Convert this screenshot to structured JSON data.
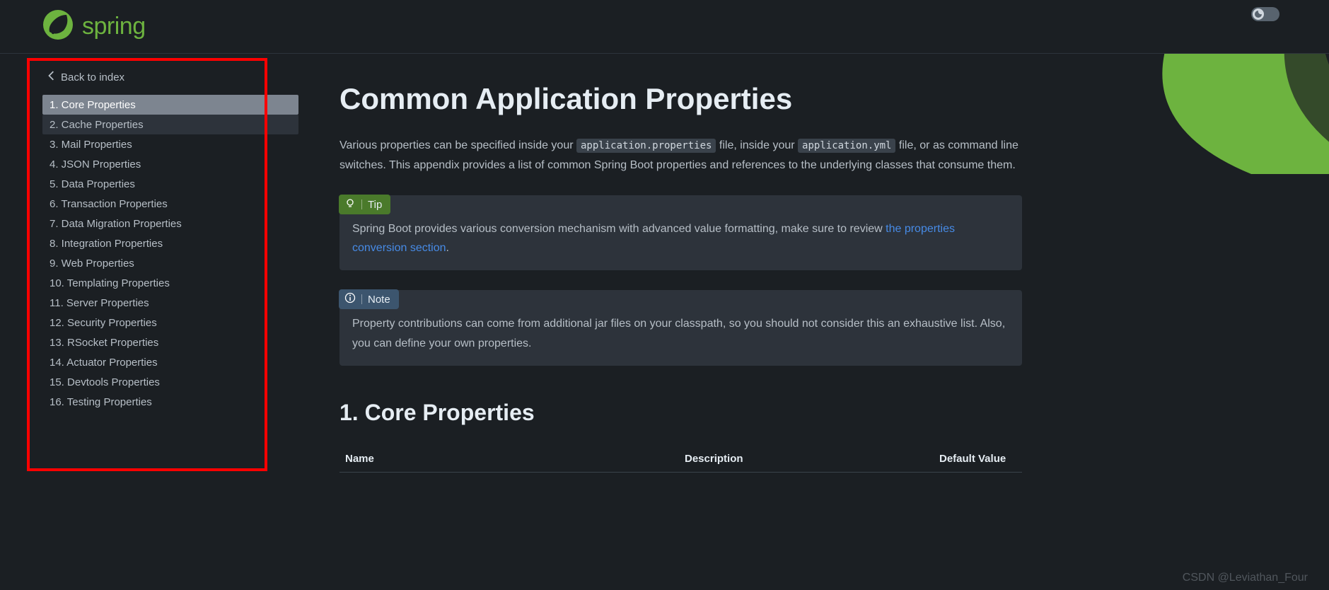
{
  "header": {
    "brand": "spring"
  },
  "sidebar": {
    "back_label": "Back to index",
    "items": [
      "1. Core Properties",
      "2. Cache Properties",
      "3. Mail Properties",
      "4. JSON Properties",
      "5. Data Properties",
      "6. Transaction Properties",
      "7. Data Migration Properties",
      "8. Integration Properties",
      "9. Web Properties",
      "10. Templating Properties",
      "11. Server Properties",
      "12. Security Properties",
      "13. RSocket Properties",
      "14. Actuator Properties",
      "15. Devtools Properties",
      "16. Testing Properties"
    ]
  },
  "content": {
    "title": "Common Application Properties",
    "intro_1": "Various properties can be specified inside your ",
    "intro_code_1": "application.properties",
    "intro_2": " file, inside your ",
    "intro_code_2": "application.yml",
    "intro_3": " file, or as command line switches. This appendix provides a list of common Spring Boot properties and references to the underlying classes that consume them.",
    "tip_label": "Tip",
    "tip_body_1": "Spring Boot provides various conversion mechanism with advanced value formatting, make sure to review ",
    "tip_link": "the properties conversion section",
    "tip_body_2": ".",
    "note_label": "Note",
    "note_body": "Property contributions can come from additional jar files on your classpath, so you should not consider this an exhaustive list. Also, you can define your own properties.",
    "section_title": "1. Core Properties",
    "table": {
      "col_name": "Name",
      "col_desc": "Description",
      "col_default": "Default Value"
    }
  },
  "watermark": "CSDN @Leviathan_Four"
}
